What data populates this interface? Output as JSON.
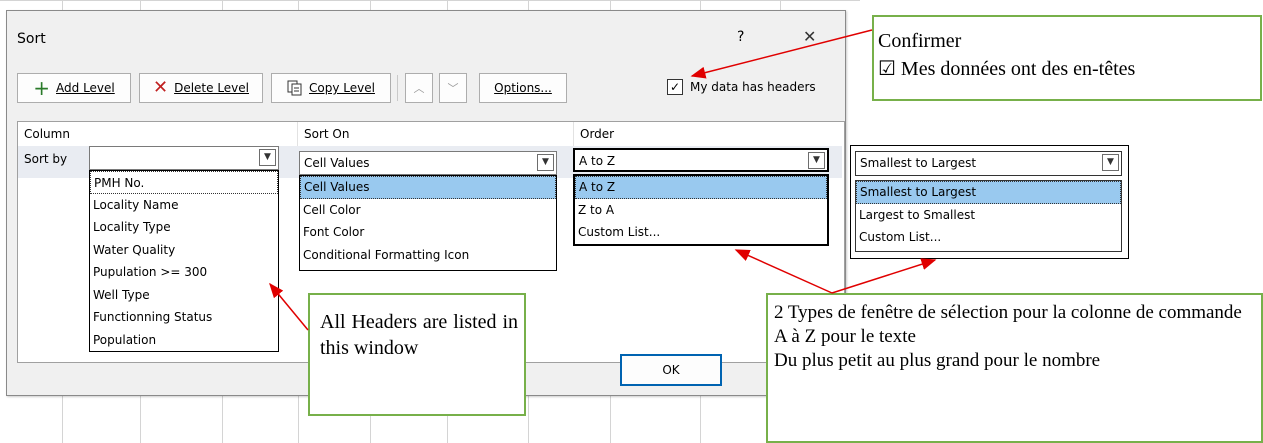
{
  "dialog": {
    "title": "Sort",
    "help_label": "?",
    "close_label": "✕",
    "toolbar": {
      "add_level_label": "Add Level",
      "delete_level_label": "Delete Level",
      "copy_level_label": "Copy Level",
      "options_label": "Options..."
    },
    "headers_checkbox": {
      "checked": true,
      "label": "My data has headers"
    },
    "columns": {
      "column": "Column",
      "sort_on": "Sort On",
      "order": "Order"
    },
    "row": {
      "sort_by_label": "Sort by",
      "column_value": "",
      "sort_on_value": "Cell Values",
      "order_value": "A to Z"
    },
    "column_options": [
      "PMH No.",
      "Locality Name",
      "Locality Type",
      "Water Quality",
      "Pupulation >= 300",
      "Well Type",
      "Functionning Status",
      "Population"
    ],
    "sort_on_options": [
      "Cell Values",
      "Cell Color",
      "Font Color",
      "Conditional Formatting Icon"
    ],
    "order_text_options": [
      "A to Z",
      "Z to A",
      "Custom List..."
    ],
    "ok_label": "OK"
  },
  "numeric_order": {
    "value": "Smallest to Largest",
    "options": [
      "Smallest to Largest",
      "Largest to Smallest",
      "Custom List..."
    ]
  },
  "callouts": {
    "confirm": {
      "line1": "Confirmer",
      "line2": "☑ Mes données ont des en-têtes"
    },
    "headers": "All Headers are listed in this window",
    "types": {
      "line1": "2 Types de fenêtre de sélection pour la colonne de commande",
      "line2": "A à Z pour le texte",
      "line3": "Du plus petit au plus grand pour le nombre"
    }
  },
  "colors": {
    "selection": "#99c9ef",
    "callout_border": "#77b04a",
    "arrow": "#e00000"
  }
}
